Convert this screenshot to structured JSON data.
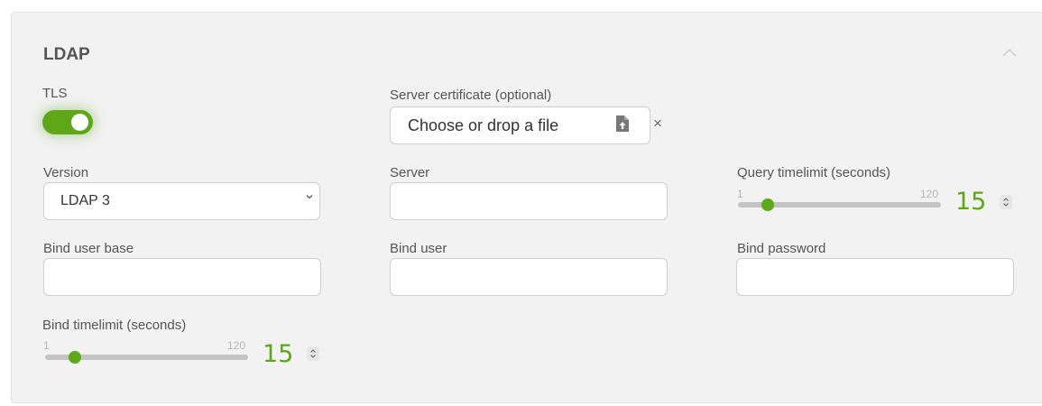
{
  "section": {
    "title": "LDAP"
  },
  "tls": {
    "label": "TLS",
    "enabled": true
  },
  "certificate": {
    "label": "Server certificate (optional)",
    "placeholder": "Choose or drop a file",
    "clear_symbol": "×"
  },
  "version": {
    "label": "Version",
    "selected": "LDAP 3"
  },
  "server": {
    "label": "Server",
    "value": ""
  },
  "query_timelimit": {
    "label": "Query timelimit (seconds)",
    "min": "1",
    "max": "120",
    "value": "15"
  },
  "bind_user_base": {
    "label": "Bind user base",
    "value": ""
  },
  "bind_user": {
    "label": "Bind user",
    "value": ""
  },
  "bind_password": {
    "label": "Bind password",
    "value": ""
  },
  "bind_timelimit": {
    "label": "Bind timelimit (seconds)",
    "min": "1",
    "max": "120",
    "value": "15"
  },
  "colors": {
    "accent": "#5da718",
    "panel_bg": "#f2f2f2"
  },
  "icons": {
    "collapse": "chevron-up-icon",
    "file": "file-upload-icon",
    "clear": "close-icon",
    "select": "chevron-down-icon",
    "spin": "spinner-arrows-icon"
  }
}
